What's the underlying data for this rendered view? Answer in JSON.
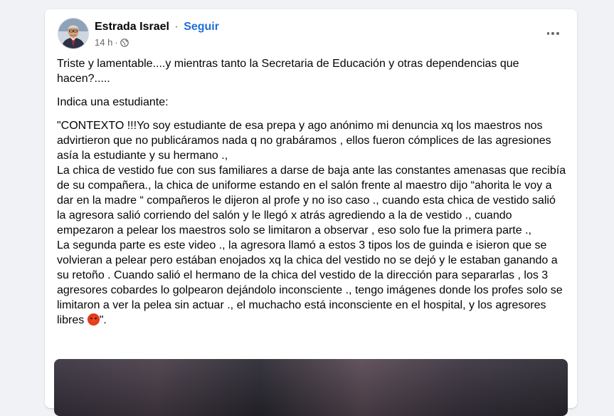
{
  "post": {
    "author": "Estrada Israel",
    "separator": "·",
    "follow_label": "Seguir",
    "time": "14 h",
    "meta_separator": "·",
    "privacy_icon": "globe-icon",
    "more_icon": "more-options-icon",
    "paragraphs": [
      "Triste y lamentable....y mientras tanto la Secretaria de Educación y otras dependencias que hacen?.....",
      "Indica una estudiante:"
    ],
    "context_lines": [
      "\"CONTEXTO !!!Yo soy estudiante de esa prepa y ago anónimo mi denuncia xq los maestros nos advirtieron que no publicáramos nada q no  grabáramos , ellos fueron cómplices de las agresiones asía la estudiante y su hermano .,",
      "La chica de vestido fue con sus familiares a darse de baja ante las constantes amenasas que recibía de su compañera., la chica de uniforme estando en el salón frente al maestro dijo “ahorita le voy a dar en la madre “  compañeros le dijeron al profe y no iso caso ., cuando esta chica de vestido salió  la agresora  salió corriendo del salón y le llegó x atrás agrediendo a la de vestido ., cuando empezaron a pelear los maestros solo se limitaron a observar , eso solo fue la primera parte .,",
      "La segunda parte es este video ., la agresora llamó a estos 3 tipos los de guinda e isieron que se volvieran a pelear pero estában enojados xq la chica del vestido no se dejó y le estaban ganando a su retoño . Cuando salió el hermano de la chica del vestido de la dirección para separarlas , los 3 agresores cobardes lo golpearon dejándolo inconsciente ., tengo imágenes donde los profes solo se limitaron a ver la pelea sin actuar ., el muchacho está inconsciente en el hospital, y los agresores libres"
    ],
    "emoji_icon": "angry-face-emoji-icon",
    "closing_quote": "\".",
    "colors": {
      "link": "#216fdb",
      "text": "#050505",
      "secondary": "#65676b",
      "background": "#f0f2f5"
    }
  }
}
